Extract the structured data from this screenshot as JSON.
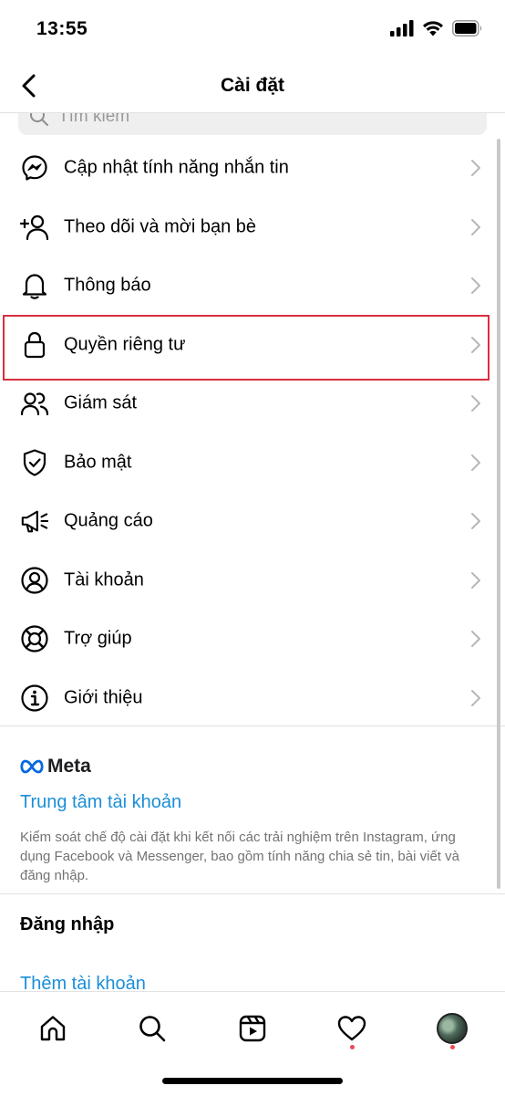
{
  "status_bar": {
    "time": "13:55"
  },
  "header": {
    "title": "Cài đặt"
  },
  "search": {
    "placeholder": "Tìm kiếm"
  },
  "menu": [
    {
      "label": "Cập nhật tính năng nhắn tin",
      "icon": "messenger-icon"
    },
    {
      "label": "Theo dõi và mời bạn bè",
      "icon": "add-person-icon"
    },
    {
      "label": "Thông báo",
      "icon": "bell-icon"
    },
    {
      "label": "Quyền riêng tư",
      "icon": "lock-icon",
      "highlighted": true
    },
    {
      "label": "Giám sát",
      "icon": "supervision-icon"
    },
    {
      "label": "Bảo mật",
      "icon": "shield-check-icon"
    },
    {
      "label": "Quảng cáo",
      "icon": "megaphone-icon"
    },
    {
      "label": "Tài khoản",
      "icon": "account-circle-icon"
    },
    {
      "label": "Trợ giúp",
      "icon": "lifebuoy-icon"
    },
    {
      "label": "Giới thiệu",
      "icon": "info-icon"
    }
  ],
  "meta": {
    "brand": "Meta",
    "accounts_center": "Trung tâm tài khoản",
    "description": "Kiểm soát chế độ cài đặt khi kết nối các trải nghiệm trên Instagram, ứng dụng Facebook và Messenger, bao gồm tính năng chia sẻ tin, bài viết và đăng nhập."
  },
  "login": {
    "title": "Đăng nhập",
    "add_account": "Thêm tài khoản"
  },
  "tab_bar": [
    "home-icon",
    "search-icon",
    "reels-icon",
    "heart-icon",
    "profile-avatar"
  ],
  "colors": {
    "link": "#1a8fd8",
    "highlight_border": "#d7303e",
    "notification_dot": "#ed4956",
    "secondary_text": "#737373"
  }
}
